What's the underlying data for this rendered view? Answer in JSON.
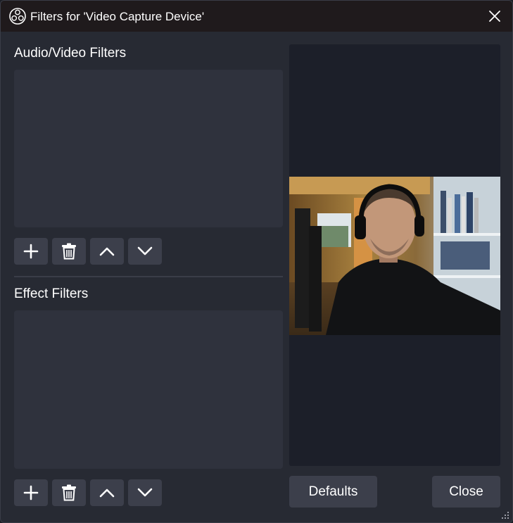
{
  "window": {
    "title": "Filters for 'Video Capture Device'",
    "app_icon": "obs-logo-icon",
    "close_icon": "close-icon"
  },
  "audio_video_filters": {
    "label": "Audio/Video Filters",
    "items": [],
    "toolbar": [
      "add-icon",
      "trash-icon",
      "chevron-up-icon",
      "chevron-down-icon"
    ]
  },
  "effect_filters": {
    "label": "Effect Filters",
    "items": [],
    "toolbar": [
      "add-icon",
      "trash-icon",
      "chevron-up-icon",
      "chevron-down-icon"
    ]
  },
  "buttons": {
    "defaults": "Defaults",
    "close": "Close"
  },
  "colors": {
    "window_bg": "#272a33",
    "titlebar_bg": "#1f1a1c",
    "list_bg": "#2f323d",
    "button_bg": "#3c3f4b",
    "preview_bg": "#1c1f29"
  }
}
